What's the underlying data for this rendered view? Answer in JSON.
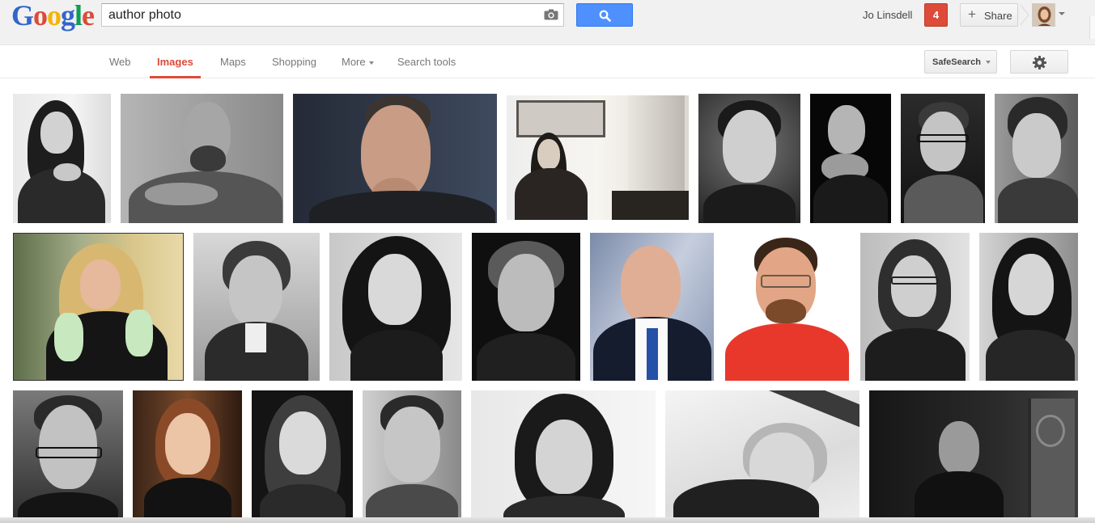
{
  "logo": {
    "letters": [
      "G",
      "o",
      "o",
      "g",
      "l",
      "e"
    ],
    "colors": [
      "#3366cc",
      "#dd4b39",
      "#f4b400",
      "#3366cc",
      "#109d58",
      "#dd4b39"
    ]
  },
  "search": {
    "query": "author photo",
    "camera_icon": "camera-icon",
    "button_icon": "magnifier-icon"
  },
  "account": {
    "user_name": "Jo Linsdell",
    "notification_count": "4",
    "share_label": "Share"
  },
  "nav": {
    "tabs": [
      {
        "label": "Web",
        "active": false
      },
      {
        "label": "Images",
        "active": true
      },
      {
        "label": "Maps",
        "active": false
      },
      {
        "label": "Shopping",
        "active": false
      },
      {
        "label": "More",
        "active": false,
        "dropdown": true
      },
      {
        "label": "Search tools",
        "active": false
      }
    ],
    "safesearch_label": "SafeSearch",
    "settings_icon": "gear-icon"
  },
  "colors": {
    "accent_red": "#dd4b39",
    "search_blue": "#4d90fe",
    "topbar_bg": "#f1f1f1"
  },
  "results": {
    "rows": [
      {
        "count": 8,
        "style": "black-and-white portraits"
      },
      {
        "count": 8,
        "style": "mixed color and black-and-white portraits"
      },
      {
        "count": 7,
        "style": "mixed color and black-and-white portraits"
      }
    ]
  }
}
